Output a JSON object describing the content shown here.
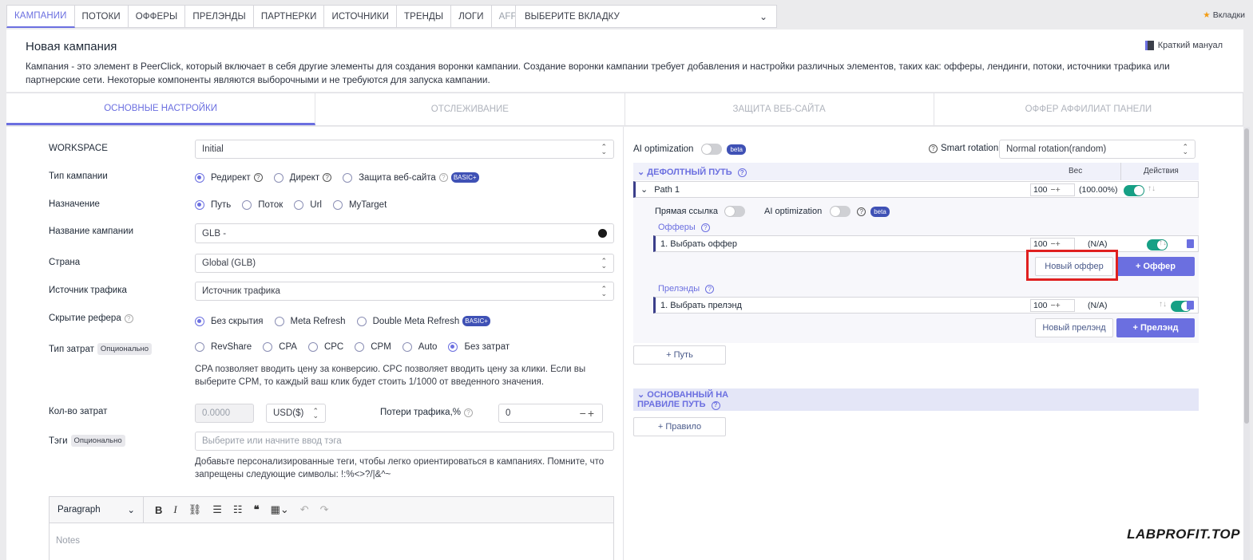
{
  "topnav": {
    "tabs": [
      "КАМПАНИИ",
      "ПОТОКИ",
      "ОФФЕРЫ",
      "ПРЕЛЭНДЫ",
      "ПАРТНЕРКИ",
      "ИСТОЧНИКИ",
      "ТРЕНДЫ",
      "ЛОГИ",
      "AFFILIATE PANEL"
    ],
    "select_label": "ВЫБЕРИТЕ ВКЛАДКУ",
    "bookmarks": "Вкладки"
  },
  "header": {
    "title": "Новая кампания",
    "manual": "Краткий мануал",
    "description": "Кампания - это элемент в PeerClick, который включает в себя другие элементы для создания воронки кампании. Создание воронки кампании требует добавления и настройки различных элементов, таких как: офферы, лендинги, потоки, источники трафика или партнерские сети. Некоторые компоненты являются выборочными и не требуются для запуска кампании."
  },
  "section_tabs": [
    "ОСНОВНЫЕ НАСТРОЙКИ",
    "ОТСЛЕЖИВАНИЕ",
    "ЗАЩИТА ВЕБ-САЙТА",
    "ОФФЕР АФФИЛИАТ ПАНЕЛИ"
  ],
  "form": {
    "workspace_label": "WORKSPACE",
    "workspace_value": "Initial",
    "campaign_type_label": "Тип кампании",
    "campaign_type_options": [
      "Редирект",
      "Директ",
      "Защита веб-сайта"
    ],
    "campaign_type_badge": "BASIC+",
    "destination_label": "Назначение",
    "destination_options": [
      "Путь",
      "Поток",
      "Url",
      "MyTarget"
    ],
    "name_label": "Название кампании",
    "name_value": "GLB -",
    "country_label": "Страна",
    "country_value": "Global (GLB)",
    "source_label": "Источник трафика",
    "source_value": "Источник трафика",
    "referer_label": "Скрытие рефера",
    "referer_options": [
      "Без скрытия",
      "Meta Refresh",
      "Double Meta Refresh"
    ],
    "referer_badge": "BASIC+",
    "cost_type_label": "Тип затрат",
    "optional": "Опционально",
    "cost_type_options": [
      "RevShare",
      "CPA",
      "CPC",
      "CPM",
      "Auto",
      "Без затрат"
    ],
    "cost_help": "CPA позволяет вводить цену за конверсию. CPC позволяет вводить цену за клики. Если вы выберите CPM, то каждый ваш клик будет стоить 1/1000 от введенного значения.",
    "cost_amount_label": "Кол-во затрат",
    "cost_amount_value": "0.0000",
    "currency": "USD($)",
    "traffic_loss_label": "Потери трафика,%",
    "traffic_loss_value": "0",
    "tags_label": "Тэги",
    "tags_placeholder": "Выберите или начните ввод тэга",
    "tags_help": "Добавьте персонализированные теги, чтобы легко ориентироваться в кампаниях. Помните, что запрещены следующие символы: !:%<>?/|&^~",
    "editor_paragraph": "Paragraph",
    "notes_placeholder": "Notes"
  },
  "right": {
    "ai_label": "AI optimization",
    "beta": "beta",
    "smart_rotation_label": "Smart rotation:",
    "smart_rotation_value": "Normal rotation(random)",
    "default_path": "ДЕФОЛТНЫЙ ПУТЬ",
    "weight_header": "Вес",
    "actions_header": "Действия",
    "path_name": "Path 1",
    "path_weight": "100",
    "path_percent": "(100.00%)",
    "direct_link": "Прямая ссылка",
    "offers_label": "Офферы",
    "offer_row": "1. Выбрать оффер",
    "offer_weight": "100",
    "offer_percent": "(N/A)",
    "new_offer": "Новый оффер",
    "add_offer": "+ Оффер",
    "landers_label": "Прелэнды",
    "lander_row": "1. Выбрать прелэнд",
    "lander_weight": "100",
    "lander_percent": "(N/A)",
    "new_lander": "Новый прелэнд",
    "add_lander": "+ Прелэнд",
    "add_path": "+ Путь",
    "rule_path": "ОСНОВАННЫЙ НА ПРАВИЛЕ ПУТЬ",
    "add_rule": "+ Правило"
  },
  "watermark": "LABPROFIT.TOP"
}
